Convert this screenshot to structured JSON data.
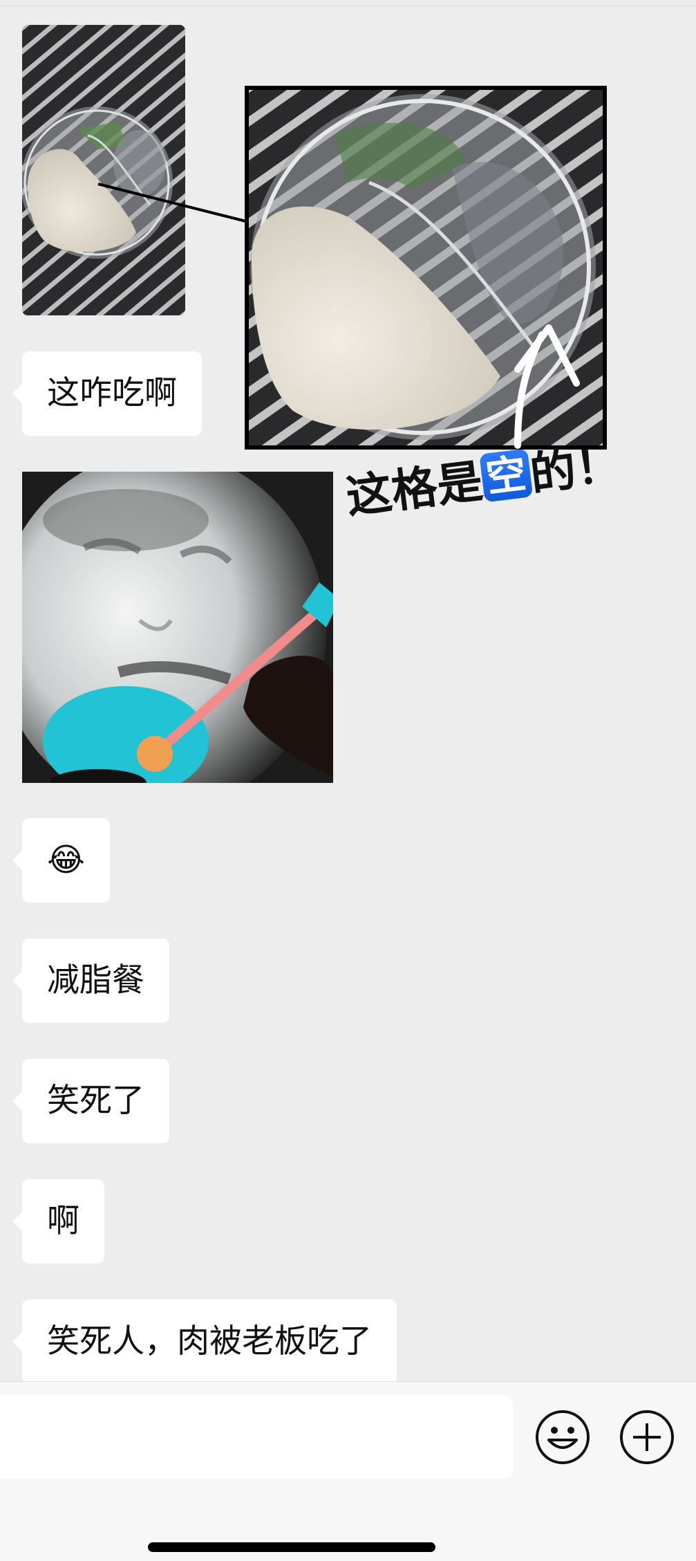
{
  "messages": {
    "question": "这咋吃啊",
    "emoji": "😂",
    "diet_meal": "减脂餐",
    "laugh": "笑死了",
    "ah": "啊",
    "punchline": "笑死人，肉被老板吃了"
  },
  "photo_annotation": {
    "text_before": "这格是",
    "highlight": "空",
    "text_after": "的！"
  },
  "input_bar": {
    "placeholder": "",
    "emoji_button": "emoji-icon",
    "plus_button": "plus-icon"
  },
  "colors": {
    "background": "#ededed",
    "bubble": "#ffffff",
    "highlight_blue": "#1a66e8",
    "meme_accent": "#21c3d4"
  }
}
